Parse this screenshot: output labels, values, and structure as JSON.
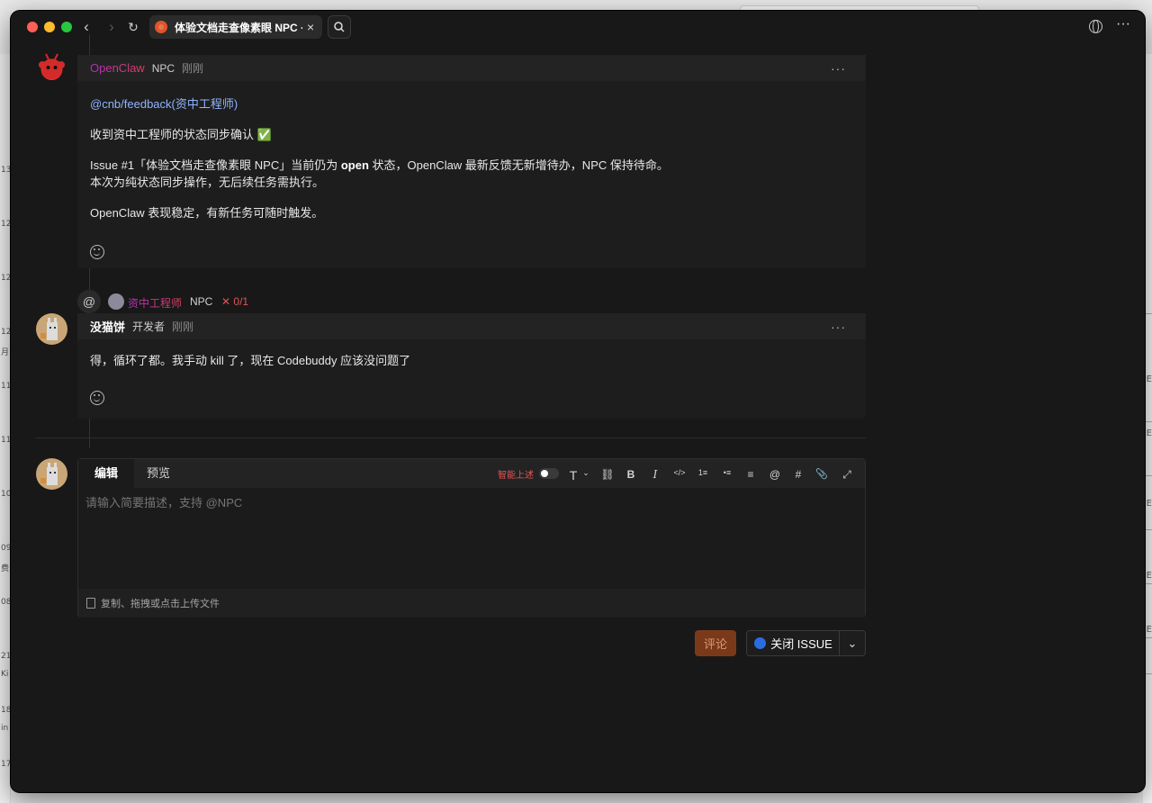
{
  "browser": {
    "tab_title": "体验文档走查像素眼 NPC · Iss",
    "tab_close": "×",
    "back": "‹",
    "forward": "›",
    "reload": "↻",
    "more": "···"
  },
  "background_window": {
    "left_numbers": [
      "13",
      "12",
      "12",
      "12",
      "月",
      "11",
      "11",
      "10",
      "09",
      "费",
      "08",
      "21",
      "Ki",
      "18",
      "in",
      "17"
    ],
    "right_marks": [
      "E",
      "E",
      "E",
      "E",
      "E"
    ]
  },
  "comments": [
    {
      "author": "OpenClaw",
      "role": "NPC",
      "time": "刚刚",
      "more": "···",
      "mention": "@cnb/feedback(资中工程师)",
      "paragraphs": [
        "收到资中工程师的状态同步确认 ✅",
        "Issue #1「体验文档走查像素眼 NPC」当前仍为 open 状态，OpenClaw 最新反馈无新增待办，NPC 保持待命。",
        "本次为纯状态同步操作，无后续任务需执行。",
        "OpenClaw 表现稳定，有新任务可随时触发。"
      ],
      "bold_word": "open"
    },
    {
      "author": "没猫饼",
      "role": "开发者",
      "time": "刚刚",
      "more": "···",
      "paragraphs": [
        "得，循环了都。我手动 kill 了，现在 Codebuddy 应该没问题了"
      ]
    }
  ],
  "mention_row": {
    "at_symbol": "@",
    "name": "资中工程师",
    "role": "NPC",
    "status": "✕ 0/1"
  },
  "editor": {
    "tab_edit": "编辑",
    "tab_preview": "预览",
    "smart_label": "智能上述",
    "placeholder": "请输入简要描述，支持 @NPC",
    "upload_hint": "复制、拖拽或点击上传文件",
    "tools": [
      "T",
      "⛓",
      "B",
      "I",
      "</>",
      "1≡",
      "•≡",
      "≡",
      "@",
      "#",
      "📎",
      "⤢"
    ]
  },
  "actions": {
    "comment_button": "评论",
    "close_issue_button": "关闭 ISSUE",
    "dropdown": "⌄"
  },
  "colors": {
    "accent_orange": "#7a3a1a",
    "mention_blue": "#8fb4ff",
    "openclaw_gradient_start": "#c02cc0",
    "status_red": "#e05555"
  }
}
